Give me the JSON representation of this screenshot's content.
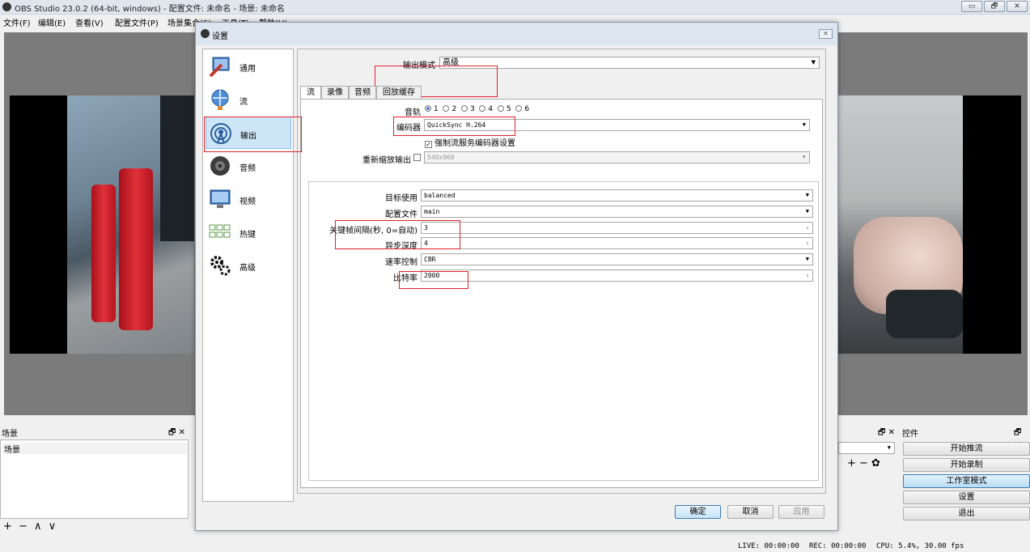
{
  "window": {
    "title": "OBS Studio 23.0.2 (64-bit, windows) - 配置文件: 未命名 - 场景: 未命名",
    "controls": [
      "▭",
      "🗗",
      "✕"
    ]
  },
  "menu": [
    "文件(F)",
    "编辑(E)",
    "查看(V)",
    "配置文件(P)",
    "场景集合(S)",
    "工具(T)",
    "帮助(H)"
  ],
  "docks": {
    "scenes_title": "场景",
    "scenes_item": "场景",
    "scenes_tools": "+ −  ∧ ∨",
    "controls_title": "控件",
    "dock_icons": "🗗 ✕",
    "mixer_tools": "+ − ✿"
  },
  "controls": {
    "start_stream": "开始推流",
    "start_record": "开始录制",
    "studio_mode": "工作室模式",
    "settings": "设置",
    "exit": "退出"
  },
  "status": {
    "live": "LIVE: 00:00:00",
    "rec": "REC: 00:00:00",
    "cpu": "CPU: 5.4%, 30.00 fps"
  },
  "settings": {
    "title": "设置",
    "close": "✕",
    "nav": [
      {
        "label": "通用",
        "icon": "general-icon"
      },
      {
        "label": "流",
        "icon": "stream-icon"
      },
      {
        "label": "输出",
        "icon": "output-icon"
      },
      {
        "label": "音频",
        "icon": "audio-icon"
      },
      {
        "label": "视频",
        "icon": "video-icon"
      },
      {
        "label": "热键",
        "icon": "hotkeys-icon"
      },
      {
        "label": "高级",
        "icon": "advanced-icon"
      }
    ],
    "selected_nav": "输出",
    "output_mode_label": "输出模式",
    "output_mode_value": "高级",
    "tabs": [
      "流",
      "录像",
      "音频",
      "回放缓存"
    ],
    "selected_tab": "流",
    "audio_track_label": "音轨",
    "audio_tracks": [
      "1",
      "2",
      "3",
      "4",
      "5",
      "6"
    ],
    "selected_track": "1",
    "encoder_label": "编码器",
    "encoder_value": "QuickSync H.264",
    "enforce_label": "强制流服务编码器设置",
    "enforce_checked": true,
    "rescale_label": "重新缩放输出",
    "rescale_value": "540x960",
    "target_usage_label": "目标使用",
    "target_usage_value": "balanced",
    "profile_label": "配置文件",
    "profile_value": "main",
    "keyframe_label": "关键帧间隔(秒, 0=自动)",
    "keyframe_value": "3",
    "async_depth_label": "异步深度",
    "async_depth_value": "4",
    "rate_control_label": "速率控制",
    "rate_control_value": "CBR",
    "bitrate_label": "比特率",
    "bitrate_value": "2000",
    "ok": "确定",
    "cancel": "取消",
    "apply": "应用"
  }
}
